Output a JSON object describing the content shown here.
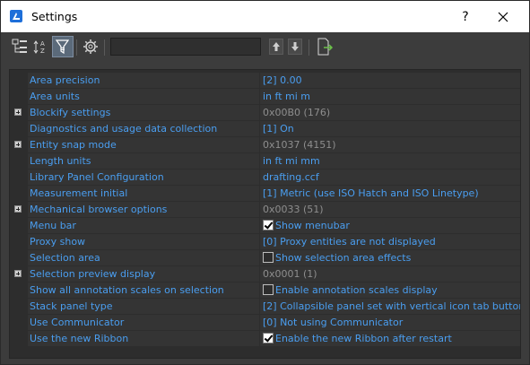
{
  "window": {
    "title": "Settings",
    "help": "?"
  },
  "toolbar": {
    "search": {
      "value": "",
      "placeholder": ""
    }
  },
  "rows": [
    {
      "name": "Area precision",
      "value": "[2] 0.00",
      "kind": "text",
      "expandable": false,
      "readonly": false
    },
    {
      "name": "Area units",
      "value": "in ft mi m",
      "kind": "text",
      "expandable": false,
      "readonly": false
    },
    {
      "name": "Blockify settings",
      "value": "0x00B0 (176)",
      "kind": "text",
      "expandable": true,
      "readonly": true
    },
    {
      "name": "Diagnostics and usage data collection",
      "value": "[1] On",
      "kind": "text",
      "expandable": false,
      "readonly": false
    },
    {
      "name": "Entity snap mode",
      "value": "0x1037 (4151)",
      "kind": "text",
      "expandable": true,
      "readonly": true
    },
    {
      "name": "Length units",
      "value": "in ft mi mm",
      "kind": "text",
      "expandable": false,
      "readonly": false
    },
    {
      "name": "Library Panel Configuration",
      "value": "drafting.ccf",
      "kind": "text",
      "expandable": false,
      "readonly": false
    },
    {
      "name": "Measurement initial",
      "value": "[1] Metric (use ISO Hatch and ISO Linetype)",
      "kind": "text",
      "expandable": false,
      "readonly": false
    },
    {
      "name": "Mechanical browser options",
      "value": "0x0033 (51)",
      "kind": "text",
      "expandable": true,
      "readonly": true
    },
    {
      "name": "Menu bar",
      "value": "Show menubar",
      "kind": "checkbox",
      "checked": true,
      "expandable": false,
      "readonly": false
    },
    {
      "name": "Proxy show",
      "value": "[0] Proxy entities are not displayed",
      "kind": "text",
      "expandable": false,
      "readonly": false
    },
    {
      "name": "Selection area",
      "value": "Show selection area effects",
      "kind": "checkbox",
      "checked": false,
      "expandable": false,
      "readonly": false
    },
    {
      "name": "Selection preview display",
      "value": "0x0001 (1)",
      "kind": "text",
      "expandable": true,
      "readonly": true
    },
    {
      "name": "Show all annotation scales on selection",
      "value": "Enable annotation scales display",
      "kind": "checkbox",
      "checked": false,
      "expandable": false,
      "readonly": false
    },
    {
      "name": "Stack panel type",
      "value": "[2] Collapsible panel set with vertical icon tab buttons (unles",
      "kind": "text",
      "expandable": false,
      "readonly": false
    },
    {
      "name": "Use Communicator",
      "value": "[0] Not using Communicator",
      "kind": "text",
      "expandable": false,
      "readonly": false
    },
    {
      "name": "Use the new Ribbon",
      "value": "Enable the new Ribbon after restart",
      "kind": "checkbox",
      "checked": true,
      "expandable": false,
      "readonly": false
    }
  ]
}
